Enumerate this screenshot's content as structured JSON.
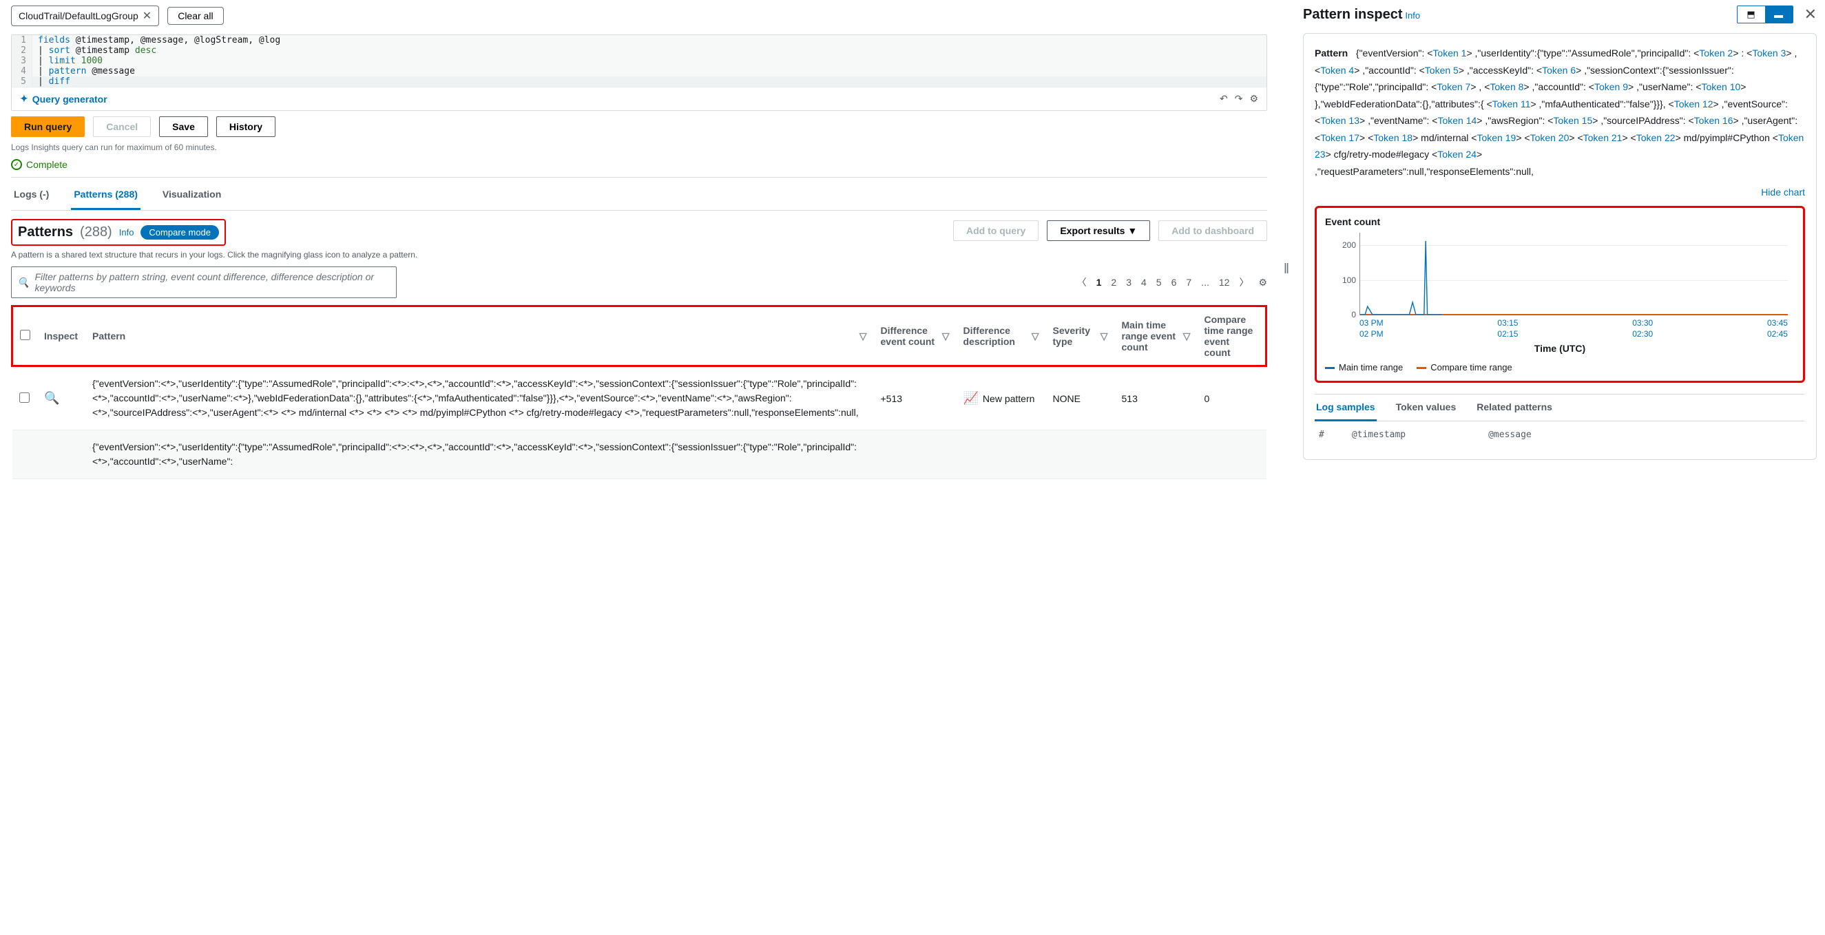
{
  "chips": {
    "log_group": "CloudTrail/DefaultLogGroup",
    "clear_all": "Clear all"
  },
  "editor": {
    "lines": [
      {
        "n": "1",
        "html": "fields @timestamp, @message, @logStream, @log"
      },
      {
        "n": "2",
        "html": "| sort @timestamp desc"
      },
      {
        "n": "3",
        "html": "| limit 1000"
      },
      {
        "n": "4",
        "html": "| pattern @message"
      },
      {
        "n": "5",
        "html": "| diff"
      }
    ],
    "query_generator": "Query generator"
  },
  "actions": {
    "run": "Run query",
    "cancel": "Cancel",
    "save": "Save",
    "history": "History",
    "hint": "Logs Insights query can run for maximum of 60 minutes.",
    "complete": "Complete"
  },
  "tabs": {
    "logs": "Logs (-)",
    "patterns": "Patterns (288)",
    "viz": "Visualization"
  },
  "patterns_header": {
    "title": "Patterns",
    "count": "(288)",
    "info": "Info",
    "compare_mode": "Compare mode",
    "actions": {
      "add_query": "Add to query",
      "export": "Export results",
      "add_dash": "Add to dashboard"
    },
    "desc": "A pattern is a shared text structure that recurs in your logs. Click the magnifying glass icon to analyze a pattern.",
    "filter_placeholder": "Filter patterns by pattern string, event count difference, difference description or keywords"
  },
  "pager": {
    "pages": [
      "1",
      "2",
      "3",
      "4",
      "5",
      "6",
      "7",
      "...",
      "12"
    ],
    "active": "1"
  },
  "table": {
    "columns": {
      "inspect": "Inspect",
      "pattern": "Pattern",
      "diff_count": "Difference event count",
      "diff_desc": "Difference description",
      "severity": "Severity type",
      "main_count": "Main time range event count",
      "compare_count": "Compare time range event count"
    },
    "rows": [
      {
        "pattern": "{\"eventVersion\":<*>,\"userIdentity\":{\"type\":\"AssumedRole\",\"principalId\":<*>:<*>,<*>,\"accountId\":<*>,\"accessKeyId\":<*>,\"sessionContext\":{\"sessionIssuer\":{\"type\":\"Role\",\"principalId\":<*>,\"accountId\":<*>,\"userName\":<*>},\"webIdFederationData\":{},\"attributes\":{<*>,\"mfaAuthenticated\":\"false\"}}},<*>,\"eventSource\":<*>,\"eventName\":<*>,\"awsRegion\":<*>,\"sourceIPAddress\":<*>,\"userAgent\":<*> <*> md/internal <*> <*> <*> <*> md/pyimpl#CPython <*> cfg/retry-mode#legacy <*>,\"requestParameters\":null,\"responseElements\":null,",
        "diff_count": "+513",
        "diff_desc": "New pattern",
        "severity": "NONE",
        "main_count": "513",
        "compare_count": "0"
      },
      {
        "pattern": "{\"eventVersion\":<*>,\"userIdentity\":{\"type\":\"AssumedRole\",\"principalId\":<*>:<*>,<*>,\"accountId\":<*>,\"accessKeyId\":<*>,\"sessionContext\":{\"sessionIssuer\":{\"type\":\"Role\",\"principalId\":<*>,\"accountId\":<*>,\"userName\":",
        "diff_count": "",
        "diff_desc": "",
        "severity": "",
        "main_count": "",
        "compare_count": ""
      }
    ]
  },
  "inspect": {
    "title": "Pattern inspect",
    "info": "Info",
    "pattern_label": "Pattern",
    "hide_chart": "Hide chart",
    "chart": {
      "title": "Event count",
      "axis_title": "Time (UTC)"
    },
    "legend": {
      "main": "Main time range",
      "compare": "Compare time range"
    },
    "subtabs": {
      "samples": "Log samples",
      "tokens": "Token values",
      "related": "Related patterns"
    },
    "sample_header": {
      "num": "#",
      "ts": "@timestamp",
      "msg": "@message"
    }
  },
  "chart_data": {
    "type": "line",
    "x": [
      "03 PM",
      "03:15",
      "03:30",
      "03:45"
    ],
    "x_compare": [
      "02 PM",
      "02:15",
      "02:30",
      "02:45"
    ],
    "ylim": [
      0,
      250
    ],
    "yticks": [
      0,
      100,
      200
    ],
    "series": [
      {
        "name": "Main time range",
        "color": "#0073bb",
        "values": [
          0,
          30,
          0,
          0,
          0,
          0,
          0,
          0,
          0,
          50,
          0,
          240,
          0
        ]
      },
      {
        "name": "Compare time range",
        "color": "#d45b07",
        "values": [
          0,
          0,
          0,
          0,
          0,
          0,
          0,
          0,
          0,
          0,
          0,
          0,
          0
        ]
      }
    ],
    "title": "Event count",
    "xlabel": "Time (UTC)",
    "ylabel": ""
  }
}
